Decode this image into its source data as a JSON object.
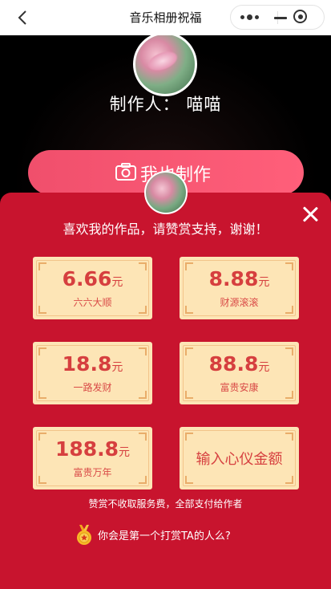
{
  "nav": {
    "title": "音乐相册祝福"
  },
  "background": {
    "maker_label": "制作人：",
    "maker_name": "喵喵",
    "make_button_label": "我也制作"
  },
  "reward": {
    "title": "喜欢我的作品，请赞赏支持，谢谢！",
    "options": [
      {
        "amount": "6.66",
        "unit": "元",
        "desc": "六六大顺"
      },
      {
        "amount": "8.88",
        "unit": "元",
        "desc": "财源滚滚"
      },
      {
        "amount": "18.8",
        "unit": "元",
        "desc": "一路发财"
      },
      {
        "amount": "88.8",
        "unit": "元",
        "desc": "富贵安康"
      },
      {
        "amount": "188.8",
        "unit": "元",
        "desc": "富贵万年"
      }
    ],
    "custom_label": "输入心仪金额",
    "note": "赞赏不收取服务费，全部支付给作者",
    "first_prompt": "你会是第一个打赏TA的人么?"
  },
  "colors": {
    "sheet_bg": "#c8142e",
    "card_bg": "#fde5b6",
    "amount_text": "#d63f3f",
    "make_button": "#f8566f"
  },
  "icons": {
    "back": "chevron-left-icon",
    "more": "more-dots-icon",
    "minimize": "minus-icon",
    "close_app": "target-icon",
    "camera": "camera-icon",
    "close_sheet": "close-icon",
    "medal": "medal-icon"
  }
}
